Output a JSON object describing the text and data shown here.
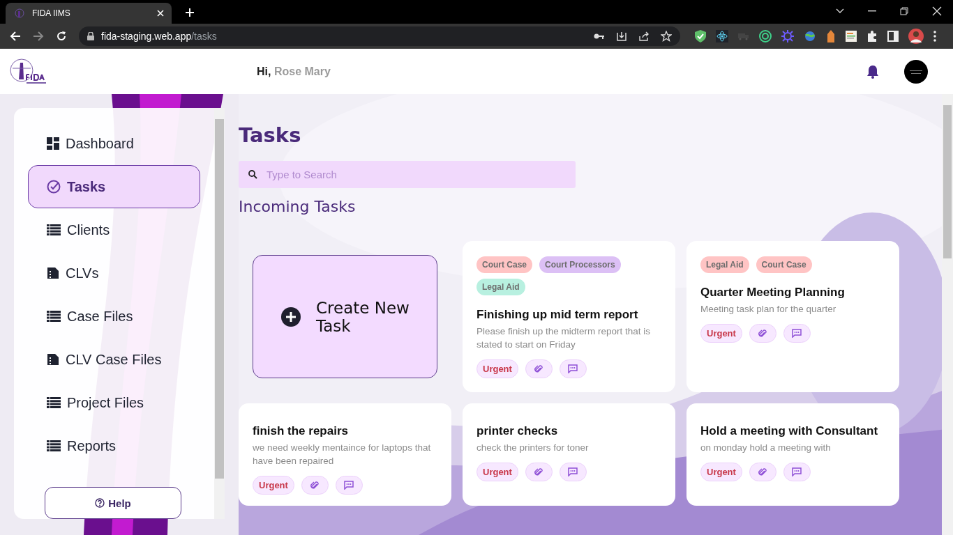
{
  "browser": {
    "tab_title": "FIDA IIMS",
    "url_host": "fida-staging.web.app",
    "url_path": "/tasks"
  },
  "header": {
    "greeting": "Hi,",
    "user_name": "Rose Mary"
  },
  "sidebar": {
    "items": [
      {
        "label": "Dashboard",
        "kind": "grid",
        "selected": false
      },
      {
        "label": "Tasks",
        "kind": "check",
        "selected": true
      },
      {
        "label": "Clients",
        "kind": "list",
        "selected": false
      },
      {
        "label": "CLVs",
        "kind": "file",
        "selected": false
      },
      {
        "label": "Case Files",
        "kind": "list",
        "selected": false
      },
      {
        "label": "CLV Case Files",
        "kind": "file",
        "selected": false
      },
      {
        "label": "Project Files",
        "kind": "list",
        "selected": false
      },
      {
        "label": "Reports",
        "kind": "list",
        "selected": false
      }
    ],
    "help": "Help"
  },
  "page": {
    "title": "Tasks",
    "search_placeholder": "Type to Search",
    "section": "Incoming Tasks"
  },
  "create_card": {
    "label": "Create New Task"
  },
  "tasks": [
    {
      "tags": [
        {
          "label": "Court Case",
          "color": "#ffc4c4"
        },
        {
          "label": "Court Processors",
          "color": "#dcc0f5"
        },
        {
          "label": "Legal Aid",
          "color": "#b8f0e0"
        }
      ],
      "title": "Finishing up mid term report",
      "description": "Please finish up the midterm report that is stated to start on Friday",
      "priority": "Urgent"
    },
    {
      "tags": [
        {
          "label": "Legal Aid",
          "color": "#ffc4c4"
        },
        {
          "label": "Court Case",
          "color": "#ffc4c4"
        }
      ],
      "title": "Quarter Meeting Planning",
      "description": "Meeting task plan for the quarter",
      "priority": "Urgent"
    },
    {
      "title": "finish the repairs",
      "description": "we need weekly mentaince for laptops that have been repaired",
      "priority": "Urgent"
    },
    {
      "title": "printer checks",
      "description": "check the printers for toner",
      "priority": "Urgent"
    },
    {
      "title": "Hold a meeting with Consultant",
      "description": "on monday hold a meeting with",
      "priority": "Urgent"
    }
  ]
}
